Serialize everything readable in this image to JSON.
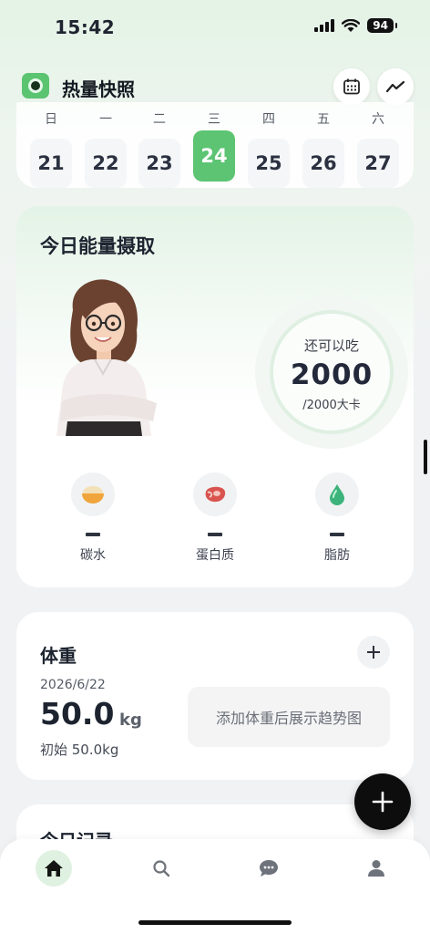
{
  "status_bar": {
    "time": "15:42",
    "battery": "94"
  },
  "header": {
    "title": "热量快照",
    "calendar_icon": "calendar-icon",
    "trend_icon": "trend-icon"
  },
  "week": {
    "days": [
      {
        "label": "日",
        "date": "21"
      },
      {
        "label": "一",
        "date": "22"
      },
      {
        "label": "二",
        "date": "23"
      },
      {
        "label": "三",
        "date": "24"
      },
      {
        "label": "四",
        "date": "25"
      },
      {
        "label": "五",
        "date": "26"
      },
      {
        "label": "六",
        "date": "27"
      }
    ],
    "selected_index": 3,
    "accent": "#5cc472"
  },
  "energy": {
    "title": "今日能量摄取",
    "ring_top": "还可以吃",
    "remaining": "2000",
    "ring_sub": "/2000大卡",
    "macros": [
      {
        "label": "碳水",
        "icon": "rice-bowl-icon"
      },
      {
        "label": "蛋白质",
        "icon": "meat-icon"
      },
      {
        "label": "脂肪",
        "icon": "oil-drop-icon"
      }
    ]
  },
  "weight": {
    "title": "体重",
    "date": "2026/6/22",
    "value": "50.0",
    "unit": "kg",
    "initial": "初始 50.0kg",
    "chart_hint": "添加体重后展示趋势图"
  },
  "today_record": {
    "title": "今日记录"
  },
  "tabs": [
    {
      "name": "home",
      "icon": "home-icon"
    },
    {
      "name": "search",
      "icon": "search-icon"
    },
    {
      "name": "chat",
      "icon": "chat-icon"
    },
    {
      "name": "profile",
      "icon": "profile-icon"
    }
  ]
}
